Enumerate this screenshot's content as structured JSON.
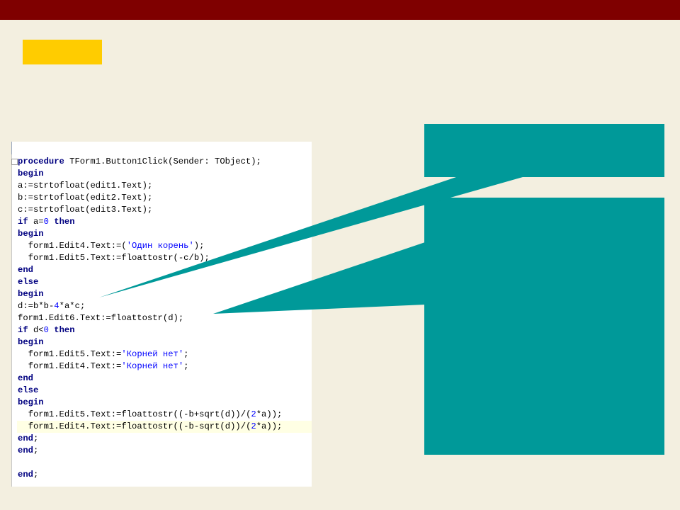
{
  "code": {
    "lines": [
      "procedure TForm1.Button1Click(Sender: TObject);",
      "begin",
      "a:=strtofloat(edit1.Text);",
      "b:=strtofloat(edit2.Text);",
      "c:=strtofloat(edit3.Text);",
      "if a=0 then",
      "begin",
      "  form1.Edit4.Text:=('Один корень');",
      "  form1.Edit5.Text:=floattostr(-c/b);",
      "end",
      "else",
      "begin",
      "d:=b*b-4*a*c;",
      "form1.Edit6.Text:=floattostr(d);",
      "if d<0 then",
      "begin",
      "  form1.Edit5.Text:='Корней нет';",
      "  form1.Edit4.Text:='Корней нет';",
      "end",
      "else",
      "begin",
      "  form1.Edit5.Text:=floattostr((-b+sqrt(d))/(2*a));",
      "  form1.Edit4.Text:=floattostr((-b-sqrt(d))/(2*a));",
      "end;",
      "end;",
      "",
      "end;"
    ]
  },
  "colors": {
    "top_bar": "#7f0000",
    "accent": "#ffcc00",
    "background": "#f3efe0",
    "callout": "#009999",
    "keyword": "#000080",
    "string": "#0000ff",
    "current_line": "#ffffe4"
  }
}
